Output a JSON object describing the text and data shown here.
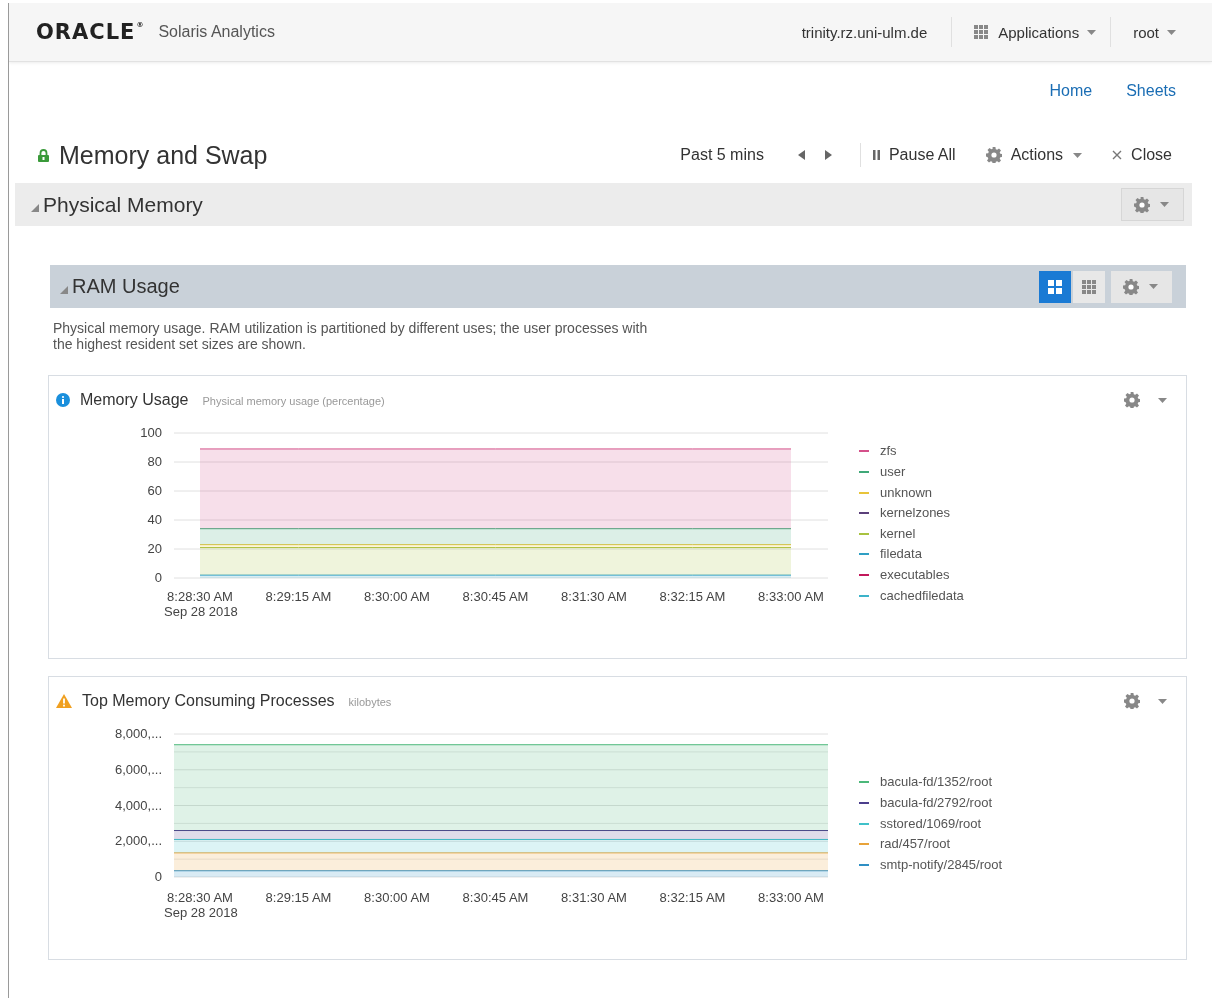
{
  "header": {
    "logo": "ORACLE$^{®}$",
    "app_name": "Solaris Analytics",
    "host": "trinity.rz.uni-ulm.de",
    "applications_menu": "Applications",
    "user_menu": "root"
  },
  "nav_links": [
    "Home",
    "Sheets"
  ],
  "sheet": {
    "title": "Memory and Swap",
    "locked": true,
    "time_range": "Past 5 mins",
    "pause_label": "Pause All",
    "actions_label": "Actions",
    "close_label": "Close"
  },
  "section": {
    "title": "Physical Memory",
    "expanded": true
  },
  "group": {
    "title": "RAM Usage",
    "expanded": true,
    "view_buttons": [
      {
        "kind": "tiles",
        "selected": true
      },
      {
        "kind": "grid",
        "selected": false
      }
    ],
    "description": "Physical memory usage. RAM utilization is partitioned by different uses; the user processes with the highest resident set sizes are shown."
  },
  "cards": [
    {
      "kind": "info",
      "title": "Memory Usage",
      "subtitle": "Physical memory usage (percentage)",
      "date_label": "Sep 28 2018",
      "chart_data": {
        "type": "area",
        "stacked": true,
        "grid": true,
        "legend": true,
        "categories": [
          "8:28:30 AM",
          "8:29:15 AM",
          "8:30:00 AM",
          "8:30:45 AM",
          "8:31:30 AM",
          "8:32:15 AM",
          "8:33:00 AM"
        ],
        "ylim": [
          0,
          100
        ],
        "yticks": [
          0,
          20,
          40,
          60,
          80,
          100
        ],
        "series": [
          {
            "name": "zfs",
            "color": "#d4508a",
            "values": [
              55,
              55,
              55,
              55,
              55,
              55,
              55
            ]
          },
          {
            "name": "user",
            "color": "#3fa878",
            "values": [
              11,
              11,
              11,
              11,
              11,
              11,
              11
            ]
          },
          {
            "name": "unknown",
            "color": "#e8c43a",
            "values": [
              2,
              2,
              2,
              2,
              2,
              2,
              2
            ]
          },
          {
            "name": "kernelzones",
            "color": "#5b3f7a",
            "values": [
              null,
              null,
              null,
              null,
              null,
              null,
              null
            ]
          },
          {
            "name": "kernel",
            "color": "#a8c23f",
            "values": [
              19,
              19,
              19,
              19,
              19,
              19,
              19
            ]
          },
          {
            "name": "filedata",
            "color": "#2f9fc4",
            "values": [
              2,
              2,
              2,
              2,
              2,
              2,
              2
            ]
          },
          {
            "name": "executables",
            "color": "#c2185b",
            "values": [
              null,
              null,
              null,
              null,
              null,
              null,
              null
            ]
          },
          {
            "name": "cachedfiledata",
            "color": "#3cb3c9",
            "values": [
              null,
              null,
              null,
              null,
              null,
              null,
              null
            ]
          }
        ]
      }
    },
    {
      "kind": "warning",
      "title": "Top Memory Consuming Processes",
      "subtitle": "kilobytes",
      "date_label": "Sep 28 2018",
      "y_labels": [
        "8,000,...",
        "6,000,...",
        "4,000,...",
        "2,000,...",
        "0"
      ],
      "x_labels": [
        "8:28:30 AM",
        "8:29:15 AM",
        "8:30:00 AM",
        "8:30:45 AM",
        "8:31:30 AM",
        "8:32:15 AM",
        "8:33:00 AM"
      ],
      "legend": [
        {
          "name": "bacula-fd/1352/root",
          "color": "#4cb87a"
        },
        {
          "name": "bacula-fd/2792/root",
          "color": "#4b3e8c"
        },
        {
          "name": "sstored/1069/root",
          "color": "#3fc1c9"
        },
        {
          "name": "rad/457/root",
          "color": "#e8a33a"
        },
        {
          "name": "smtp-notify/2845/root",
          "color": "#2f8fc4"
        }
      ]
    }
  ]
}
